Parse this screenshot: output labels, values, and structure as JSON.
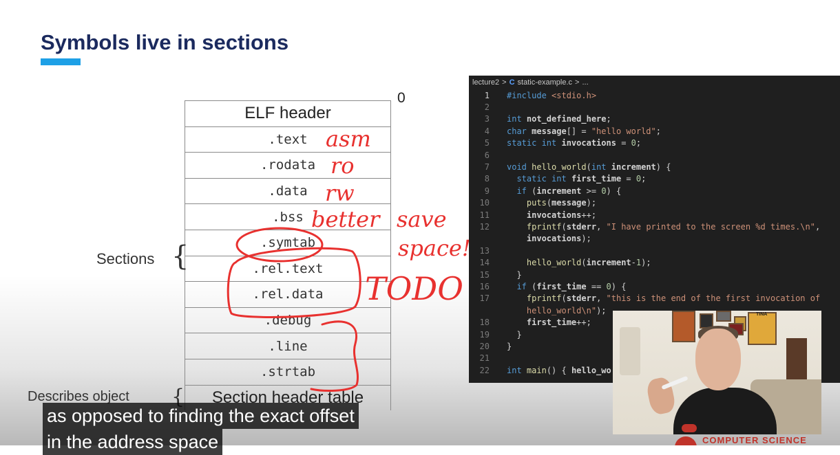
{
  "slide": {
    "title": "Symbols live in sections"
  },
  "elf_table": {
    "offset_label": "0",
    "rows": [
      "ELF header",
      ".text",
      ".rodata",
      ".data",
      ".bss",
      ".symtab",
      ".rel.text",
      ".rel.data",
      ".debug",
      ".line",
      ".strtab",
      "Section header table"
    ],
    "sections_label": "Sections",
    "describes_label": "Describes object"
  },
  "annotations": {
    "handwritten": [
      "asm",
      "ro",
      "rw",
      "better save space!",
      "TODO"
    ],
    "ink_color": "#e8312f"
  },
  "editor": {
    "breadcrumb": {
      "folder": "lecture2",
      "file_icon": "C",
      "file": "static-example.c",
      "more": "..."
    },
    "lines": [
      {
        "n": "1",
        "segs": [
          [
            "kw",
            "#include "
          ],
          [
            "str",
            "<stdio.h>"
          ]
        ]
      },
      {
        "n": "2",
        "segs": []
      },
      {
        "n": "3",
        "segs": [
          [
            "kw",
            "int "
          ],
          [
            "ident",
            "not_defined_here"
          ],
          [
            "code",
            ";"
          ]
        ]
      },
      {
        "n": "4",
        "segs": [
          [
            "kw",
            "char "
          ],
          [
            "ident",
            "message"
          ],
          [
            "code",
            "[] = "
          ],
          [
            "str",
            "\"hello world\""
          ],
          [
            "code",
            ";"
          ]
        ]
      },
      {
        "n": "5",
        "segs": [
          [
            "kw",
            "static int "
          ],
          [
            "ident",
            "invocations"
          ],
          [
            "code",
            " = "
          ],
          [
            "num",
            "0"
          ],
          [
            "code",
            ";"
          ]
        ]
      },
      {
        "n": "6",
        "segs": []
      },
      {
        "n": "7",
        "segs": [
          [
            "kw",
            "void "
          ],
          [
            "fn",
            "hello_world"
          ],
          [
            "code",
            "("
          ],
          [
            "kw",
            "int "
          ],
          [
            "ident",
            "increment"
          ],
          [
            "code",
            ") {"
          ]
        ]
      },
      {
        "n": "8",
        "segs": [
          [
            "code",
            "  "
          ],
          [
            "kw",
            "static int "
          ],
          [
            "ident",
            "first_time"
          ],
          [
            "code",
            " = "
          ],
          [
            "num",
            "0"
          ],
          [
            "code",
            ";"
          ]
        ]
      },
      {
        "n": "9",
        "segs": [
          [
            "code",
            "  "
          ],
          [
            "kw",
            "if "
          ],
          [
            "code",
            "("
          ],
          [
            "ident",
            "increment"
          ],
          [
            "code",
            " >= "
          ],
          [
            "num",
            "0"
          ],
          [
            "code",
            ") {"
          ]
        ]
      },
      {
        "n": "10",
        "segs": [
          [
            "code",
            "    "
          ],
          [
            "fn",
            "puts"
          ],
          [
            "code",
            "("
          ],
          [
            "ident",
            "message"
          ],
          [
            "code",
            ");"
          ]
        ]
      },
      {
        "n": "11",
        "segs": [
          [
            "code",
            "    "
          ],
          [
            "ident",
            "invocations"
          ],
          [
            "code",
            "++;"
          ]
        ]
      },
      {
        "n": "12",
        "segs": [
          [
            "code",
            "    "
          ],
          [
            "fn",
            "fprintf"
          ],
          [
            "code",
            "("
          ],
          [
            "ident",
            "stderr"
          ],
          [
            "code",
            ", "
          ],
          [
            "str",
            "\"I have printed to the screen %d times.\\n\""
          ],
          [
            "code",
            ","
          ]
        ]
      },
      {
        "n": "",
        "segs": [
          [
            "code",
            "    "
          ],
          [
            "ident",
            "invocations"
          ],
          [
            "code",
            ");"
          ]
        ]
      },
      {
        "n": "13",
        "segs": []
      },
      {
        "n": "14",
        "segs": [
          [
            "code",
            "    "
          ],
          [
            "fn",
            "hello_world"
          ],
          [
            "code",
            "("
          ],
          [
            "ident",
            "increment"
          ],
          [
            "code",
            "-"
          ],
          [
            "num",
            "1"
          ],
          [
            "code",
            ");"
          ]
        ]
      },
      {
        "n": "15",
        "segs": [
          [
            "code",
            "  }"
          ]
        ]
      },
      {
        "n": "16",
        "segs": [
          [
            "code",
            "  "
          ],
          [
            "kw",
            "if "
          ],
          [
            "code",
            "("
          ],
          [
            "ident",
            "first_time"
          ],
          [
            "code",
            " == "
          ],
          [
            "num",
            "0"
          ],
          [
            "code",
            ") {"
          ]
        ]
      },
      {
        "n": "17",
        "segs": [
          [
            "code",
            "    "
          ],
          [
            "fn",
            "fprintf"
          ],
          [
            "code",
            "("
          ],
          [
            "ident",
            "stderr"
          ],
          [
            "code",
            ", "
          ],
          [
            "str",
            "\"this is the end of the first invocation of"
          ]
        ]
      },
      {
        "n": "",
        "segs": [
          [
            "code",
            "    "
          ],
          [
            "str",
            "hello_world\\n\""
          ],
          [
            "code",
            ");"
          ]
        ]
      },
      {
        "n": "18",
        "segs": [
          [
            "code",
            "    "
          ],
          [
            "ident",
            "first_time"
          ],
          [
            "code",
            "++;"
          ]
        ]
      },
      {
        "n": "19",
        "segs": [
          [
            "code",
            "  }"
          ]
        ]
      },
      {
        "n": "20",
        "segs": [
          [
            "code",
            "}"
          ]
        ]
      },
      {
        "n": "21",
        "segs": []
      },
      {
        "n": "22",
        "segs": [
          [
            "kw",
            "int "
          ],
          [
            "fn",
            "main"
          ],
          [
            "code",
            "() { "
          ],
          [
            "ident",
            "hello_wo"
          ]
        ]
      }
    ]
  },
  "webcam": {
    "poster_text": "TINA",
    "speaker": "presenter"
  },
  "branding": {
    "channel_badge": "COMPUTER SCIENCE"
  },
  "captions": {
    "line1": "as opposed to finding the exact offset",
    "line2": "in the address space"
  }
}
